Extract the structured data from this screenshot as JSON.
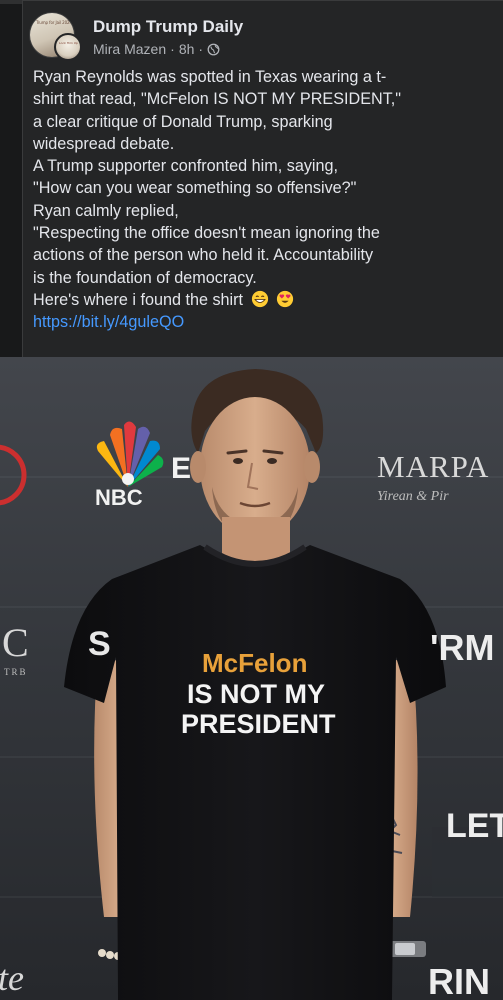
{
  "post": {
    "page_name": "Dump Trump Daily",
    "author": "Mira Mazen",
    "time": "8h",
    "separator": "·",
    "avatar_caption": "Trump for Jail 2024",
    "avatar_sub_caption": "Lock Him Up",
    "body_lines": [
      "Ryan Reynolds was spotted in Texas wearing a t-",
      "shirt that read, \"McFelon IS NOT MY PRESIDENT,\"",
      "a clear critique of Donald Trump, sparking",
      "widespread debate.",
      "A Trump supporter confronted him, saying,",
      "\"How can you wear something so offensive?\"",
      "Ryan calmly replied,",
      "\"Respecting the office doesn't mean ignoring the",
      "actions of the person who held it. Accountability",
      "is the foundation of democracy.",
      "Here's where i found the shirt"
    ],
    "link": "https://bit.ly/4guleQO"
  },
  "icons": {
    "privacy": "globe-icon",
    "emoji_1": "grinning-face-icon",
    "emoji_2": "heart-eyes-face-icon"
  },
  "photo": {
    "backdrop_logos": {
      "nbc": "NBC",
      "nbc_e": "E",
      "marpa": "MARPA",
      "marpa_sub": "Y‍ir‍ea‍n & Pi‍r",
      "left_c": "C",
      "left_tiny": "TRB",
      "right_rm": "'RM",
      "right_let": "LET",
      "bottom_left": "te",
      "bottom_right": "RIN",
      "left_s": "S"
    },
    "shirt": {
      "brand": "McFelon",
      "line1": "IS NOT MY",
      "line2": "PRESIDENT"
    }
  },
  "colors": {
    "card_bg": "#242526",
    "page_bg": "#18191a",
    "link": "#4599ff",
    "text": "#e4e6eb",
    "meta": "#b0b3b8",
    "shirt_brand": "#e8a13a",
    "nbc_red": "#e03a3e",
    "nbc_orange": "#f37021",
    "nbc_yellow": "#fcb711",
    "nbc_green": "#0db14b",
    "nbc_blue": "#0089d0",
    "nbc_purple": "#6460aa"
  }
}
